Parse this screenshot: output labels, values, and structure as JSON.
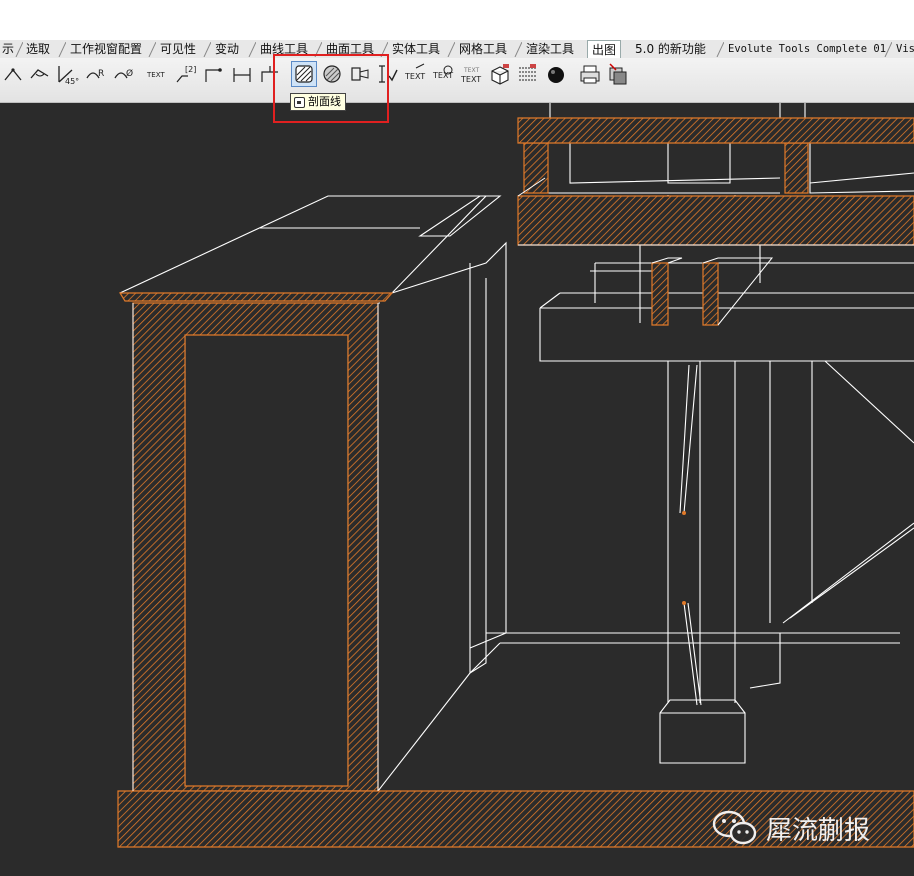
{
  "tabs": [
    {
      "label": "示"
    },
    {
      "label": "选取"
    },
    {
      "label": "工作视窗配置"
    },
    {
      "label": "可见性"
    },
    {
      "label": "变动"
    },
    {
      "label": "曲线工具"
    },
    {
      "label": "曲面工具"
    },
    {
      "label": "实体工具"
    },
    {
      "label": "网格工具"
    },
    {
      "label": "渲染工具"
    },
    {
      "label": "出图"
    },
    {
      "label": "5.0 的新功能"
    },
    {
      "label": "Evolute Tools Complete 01"
    },
    {
      "label": "Vis"
    }
  ],
  "active_tab": "出图",
  "toolbar": {
    "text_labels": {
      "text1": "TEXT",
      "dim_label": "[2]",
      "text2": "TEXT",
      "text3": "TEXT",
      "text4a": "TEXT",
      "text4b": "TEXT",
      "angle_45": "45°"
    }
  },
  "tooltip": {
    "label": "剖面线"
  },
  "watermark": {
    "text": "犀流蒯报"
  },
  "colors": {
    "hatch": "#e07a2a",
    "outline": "#ffffff",
    "viewport_bg": "#2b2b2b",
    "highlight": "#e02020"
  }
}
